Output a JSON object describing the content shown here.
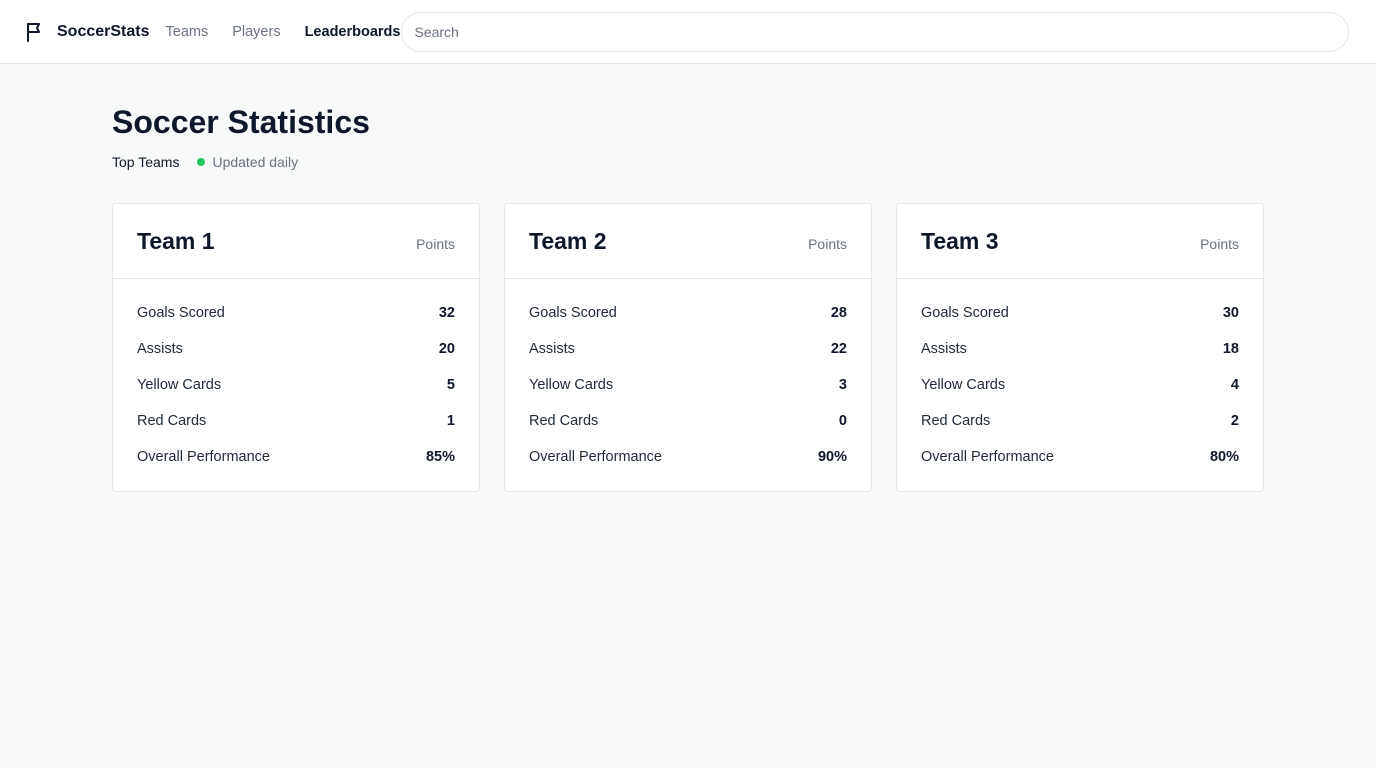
{
  "app": {
    "brand": "SoccerStats",
    "icon": "flag-icon"
  },
  "nav": {
    "items": [
      {
        "label": "Teams",
        "active": false
      },
      {
        "label": "Players",
        "active": false
      },
      {
        "label": "Leaderboards",
        "active": true
      }
    ]
  },
  "search": {
    "placeholder": "Search",
    "value": ""
  },
  "page": {
    "title": "Soccer Statistics",
    "section": "Top Teams",
    "status": "Updated daily",
    "status_color": "#22c55e"
  },
  "cards": [
    {
      "title": "Team 1",
      "points_label": "Points",
      "stats": [
        {
          "label": "Goals Scored",
          "value": "32"
        },
        {
          "label": "Assists",
          "value": "20"
        },
        {
          "label": "Yellow Cards",
          "value": "5"
        },
        {
          "label": "Red Cards",
          "value": "1"
        },
        {
          "label": "Overall Performance",
          "value": "85%"
        }
      ]
    },
    {
      "title": "Team 2",
      "points_label": "Points",
      "stats": [
        {
          "label": "Goals Scored",
          "value": "28"
        },
        {
          "label": "Assists",
          "value": "22"
        },
        {
          "label": "Yellow Cards",
          "value": "3"
        },
        {
          "label": "Red Cards",
          "value": "0"
        },
        {
          "label": "Overall Performance",
          "value": "90%"
        }
      ]
    },
    {
      "title": "Team 3",
      "points_label": "Points",
      "stats": [
        {
          "label": "Goals Scored",
          "value": "30"
        },
        {
          "label": "Assists",
          "value": "18"
        },
        {
          "label": "Yellow Cards",
          "value": "4"
        },
        {
          "label": "Red Cards",
          "value": "2"
        },
        {
          "label": "Overall Performance",
          "value": "80%"
        }
      ]
    }
  ]
}
